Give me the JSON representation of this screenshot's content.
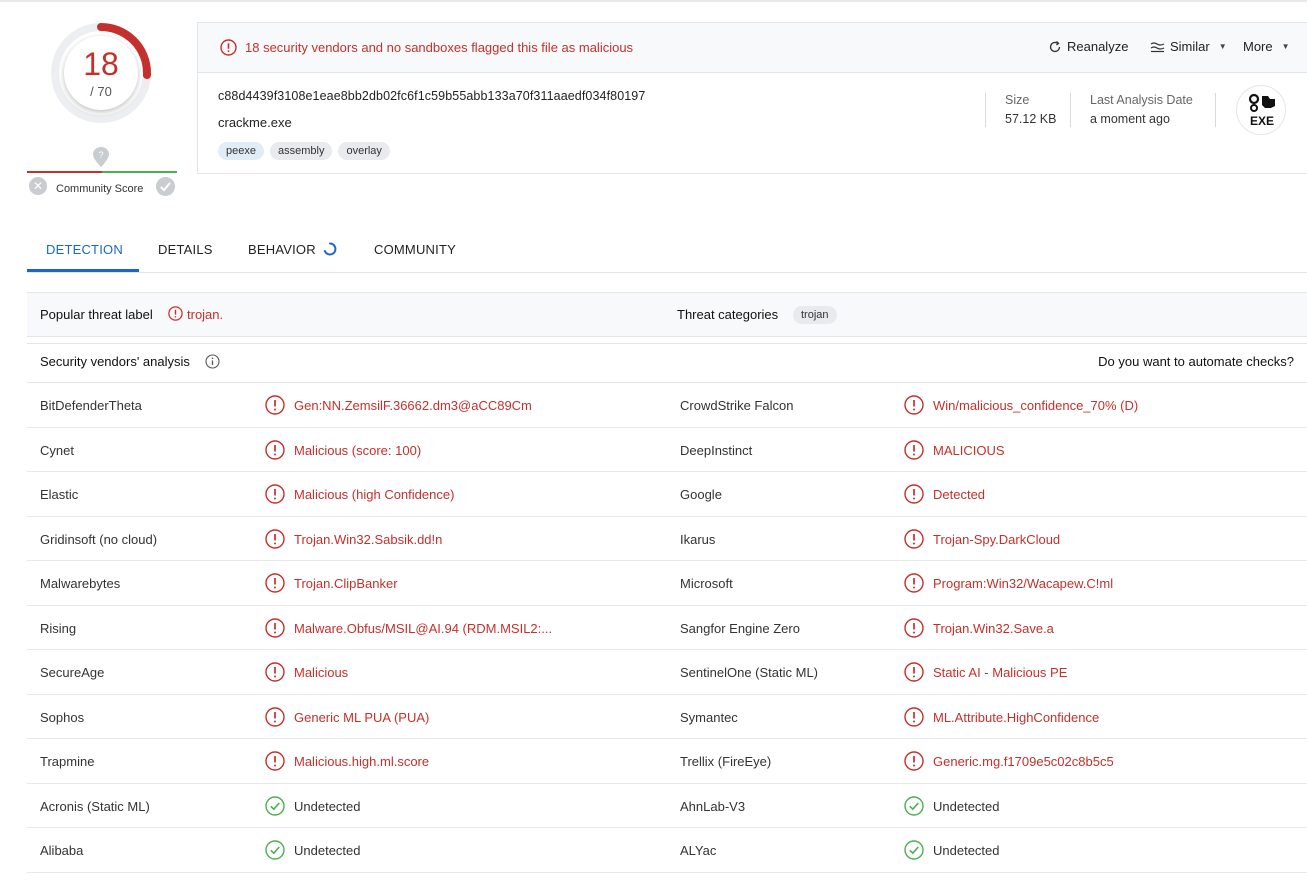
{
  "score": {
    "detected": "18",
    "total": "/ 70",
    "ratio": 0.257
  },
  "community": {
    "label": "Community Score"
  },
  "alert": {
    "text": "18 security vendors and no sandboxes flagged this file as malicious"
  },
  "actions": {
    "reanalyze": "Reanalyze",
    "similar": "Similar",
    "more": "More"
  },
  "file": {
    "hash": "c88d4439f3108e1eae8bb2db02fc6f1c59b55abb133a70f311aaedf034f80197",
    "name": "crackme.exe",
    "tags": [
      "peexe",
      "assembly",
      "overlay"
    ],
    "size_label": "Size",
    "size_value": "57.12 KB",
    "analysis_label": "Last Analysis Date",
    "analysis_value": "a moment ago",
    "type_badge": "EXE"
  },
  "tabs": [
    "DETECTION",
    "DETAILS",
    "BEHAVIOR",
    "COMMUNITY"
  ],
  "threat": {
    "popular_label": "Popular threat label",
    "popular_value": "trojan.",
    "categories_label": "Threat categories",
    "categories_tag": "trojan"
  },
  "vendors_header": {
    "title": "Security vendors' analysis",
    "automate": "Do you want to automate checks?"
  },
  "colors": {
    "malicious": "#c4302b",
    "clean": "#4caf50",
    "accent": "#1a66c9"
  },
  "rows": [
    {
      "v1": "BitDefenderTheta",
      "r1": "Gen:NN.ZemsilF.36662.dm3@aCC89Cm",
      "s1": "mal",
      "v2": "CrowdStrike Falcon",
      "r2": "Win/malicious_confidence_70% (D)",
      "s2": "mal"
    },
    {
      "v1": "Cynet",
      "r1": "Malicious (score: 100)",
      "s1": "mal",
      "v2": "DeepInstinct",
      "r2": "MALICIOUS",
      "s2": "mal"
    },
    {
      "v1": "Elastic",
      "r1": "Malicious (high Confidence)",
      "s1": "mal",
      "v2": "Google",
      "r2": "Detected",
      "s2": "mal"
    },
    {
      "v1": "Gridinsoft (no cloud)",
      "r1": "Trojan.Win32.Sabsik.dd!n",
      "s1": "mal",
      "v2": "Ikarus",
      "r2": "Trojan-Spy.DarkCloud",
      "s2": "mal"
    },
    {
      "v1": "Malwarebytes",
      "r1": "Trojan.ClipBanker",
      "s1": "mal",
      "v2": "Microsoft",
      "r2": "Program:Win32/Wacapew.C!ml",
      "s2": "mal"
    },
    {
      "v1": "Rising",
      "r1": "Malware.Obfus/MSIL@AI.94 (RDM.MSIL2:...",
      "s1": "mal",
      "v2": "Sangfor Engine Zero",
      "r2": "Trojan.Win32.Save.a",
      "s2": "mal"
    },
    {
      "v1": "SecureAge",
      "r1": "Malicious",
      "s1": "mal",
      "v2": "SentinelOne (Static ML)",
      "r2": "Static AI - Malicious PE",
      "s2": "mal"
    },
    {
      "v1": "Sophos",
      "r1": "Generic ML PUA (PUA)",
      "s1": "mal",
      "v2": "Symantec",
      "r2": "ML.Attribute.HighConfidence",
      "s2": "mal"
    },
    {
      "v1": "Trapmine",
      "r1": "Malicious.high.ml.score",
      "s1": "mal",
      "v2": "Trellix (FireEye)",
      "r2": "Generic.mg.f1709e5c02c8b5c5",
      "s2": "mal"
    },
    {
      "v1": "Acronis (Static ML)",
      "r1": "Undetected",
      "s1": "und",
      "v2": "AhnLab-V3",
      "r2": "Undetected",
      "s2": "und"
    },
    {
      "v1": "Alibaba",
      "r1": "Undetected",
      "s1": "und",
      "v2": "ALYac",
      "r2": "Undetected",
      "s2": "und"
    }
  ]
}
